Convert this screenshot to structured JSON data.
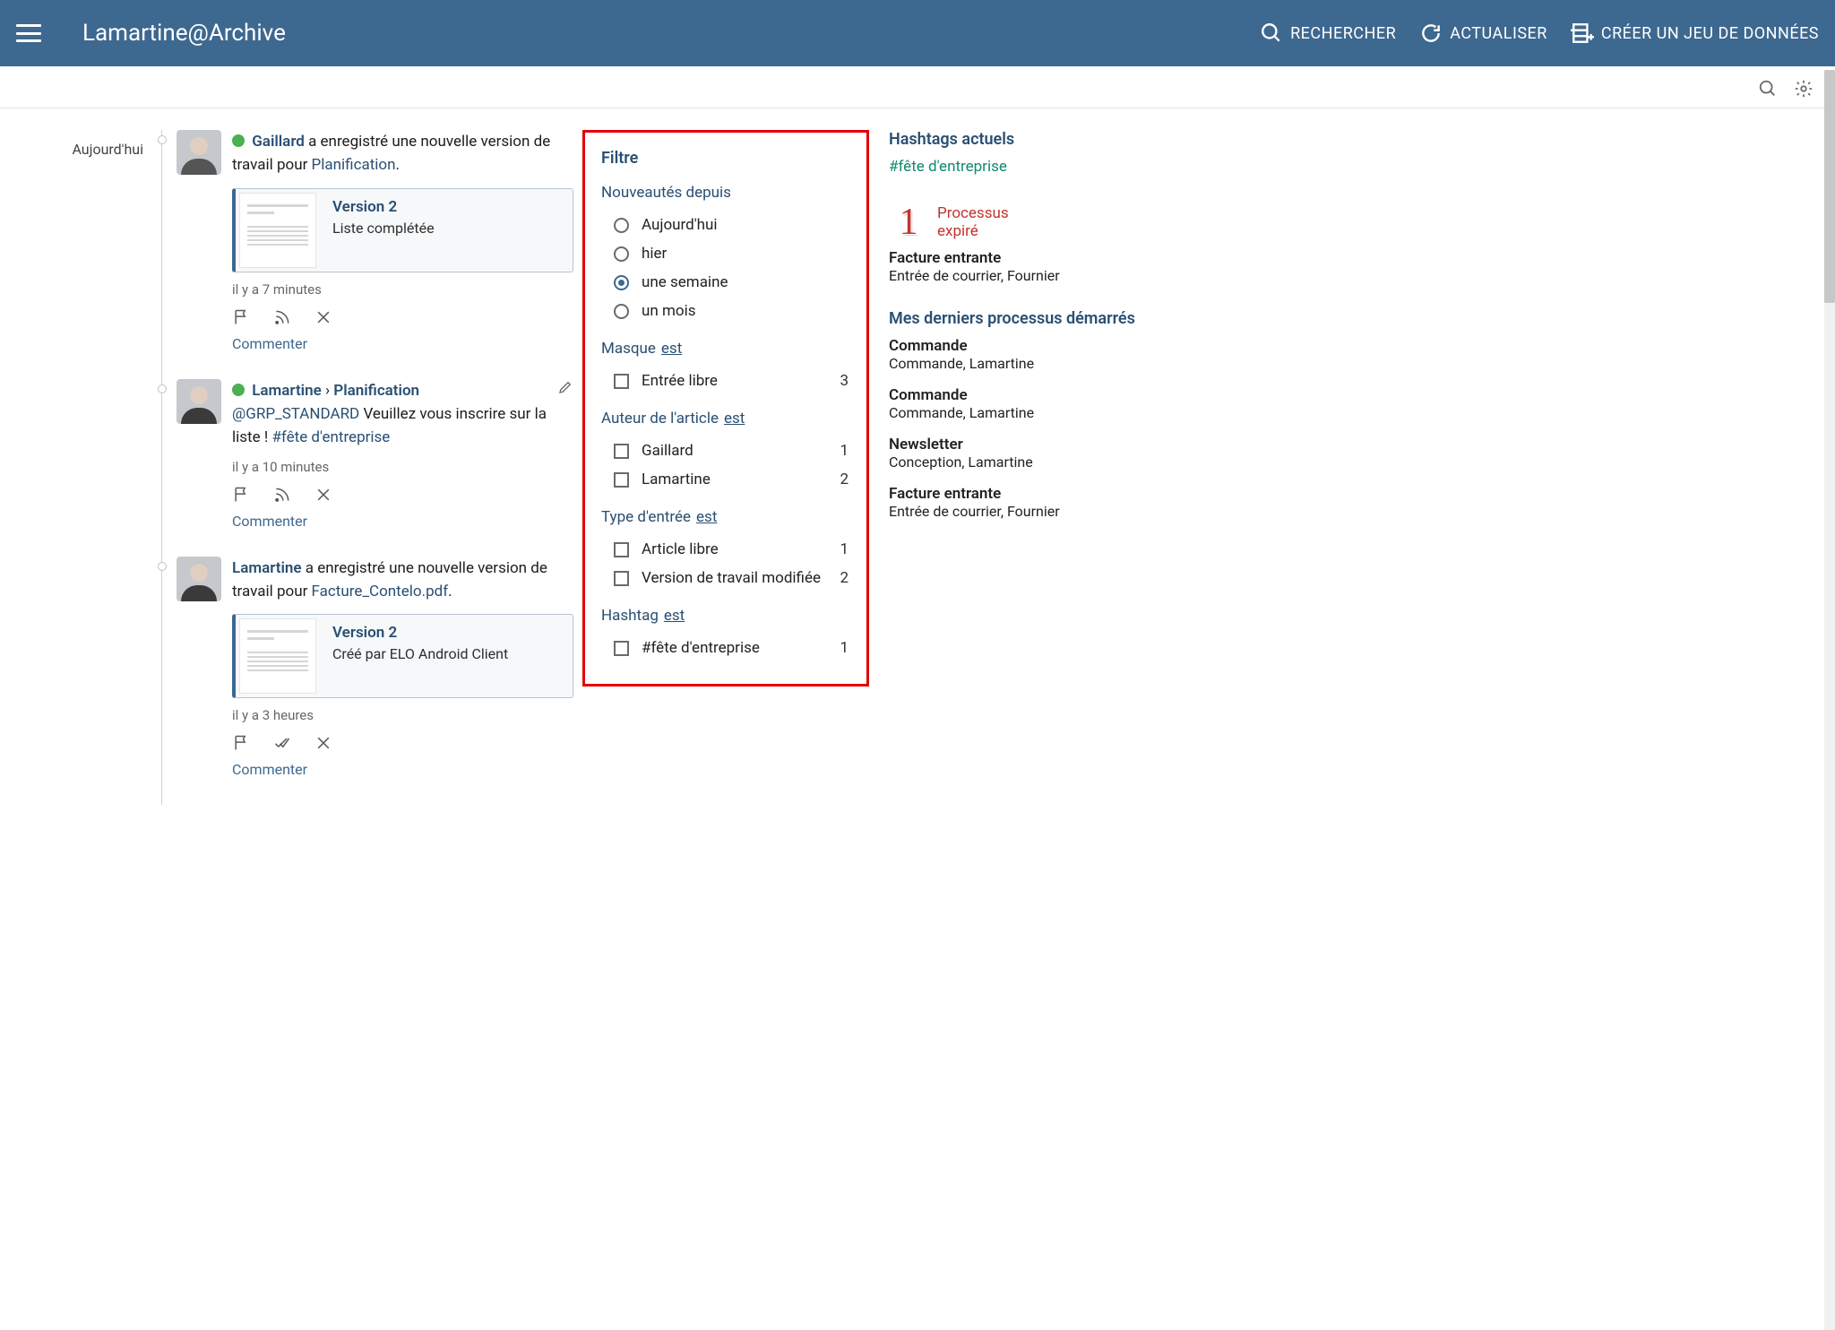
{
  "header": {
    "title": "Lamartine@Archive",
    "actions": {
      "search": "RECHERCHER",
      "refresh": "ACTUALISER",
      "create": "CRÉER UN JEU DE DONNÉES"
    }
  },
  "timeline": {
    "today_label": "Aujourd'hui"
  },
  "feed": [
    {
      "author": "Gaillard",
      "text_pre": "a enregistré une nouvelle version de travail pour",
      "object": "Planification",
      "version_card": {
        "title": "Version 2",
        "subtitle": "Liste complétée"
      },
      "time": "il y a 7 minutes",
      "comment": "Commenter",
      "online": true
    },
    {
      "author": "Lamartine",
      "crumb_sep": "›",
      "crumb_target": "Planification",
      "mention": "@GRP_STANDARD",
      "body_text": "Veuillez vous inscrire sur la liste !",
      "hashtag": "#fête d'entreprise",
      "time": "il y a 10 minutes",
      "comment": "Commenter",
      "online": true,
      "editable": true
    },
    {
      "author": "Lamartine",
      "text_pre": "a enregistré une nouvelle version de travail pour",
      "object": "Facture_Contelo.pdf",
      "version_card": {
        "title": "Version 2",
        "subtitle": "Créé par ELO Android Client"
      },
      "time": "il y a 3 heures",
      "comment": "Commenter"
    }
  ],
  "filter": {
    "title": "Filtre",
    "since_label": "Nouveautés depuis",
    "since_options": [
      "Aujourd'hui",
      "hier",
      "une semaine",
      "un mois"
    ],
    "since_selected": 2,
    "est_label": "est",
    "sections": [
      {
        "label": "Masque",
        "items": [
          {
            "label": "Entrée libre",
            "count": 3
          }
        ]
      },
      {
        "label": "Auteur de l'article",
        "items": [
          {
            "label": "Gaillard",
            "count": 1
          },
          {
            "label": "Lamartine",
            "count": 2
          }
        ]
      },
      {
        "label": "Type d'entrée",
        "items": [
          {
            "label": "Article libre",
            "count": 1
          },
          {
            "label": "Version de travail modifiée",
            "count": 2
          }
        ]
      },
      {
        "label": "Hashtag",
        "items": [
          {
            "label": "#fête d'entreprise",
            "count": 1
          }
        ]
      }
    ]
  },
  "side": {
    "hashtags_title": "Hashtags actuels",
    "hashtag": "#fête d'entreprise",
    "expired": {
      "count": "1",
      "label1": "Processus",
      "label2": "expiré",
      "title": "Facture entrante",
      "sub": "Entrée de courrier, Fournier"
    },
    "processes_title": "Mes derniers processus démarrés",
    "processes": [
      {
        "title": "Commande",
        "sub": "Commande, Lamartine"
      },
      {
        "title": "Commande",
        "sub": "Commande, Lamartine"
      },
      {
        "title": "Newsletter",
        "sub": "Conception, Lamartine"
      },
      {
        "title": "Facture entrante",
        "sub": "Entrée de courrier, Fournier"
      }
    ]
  }
}
